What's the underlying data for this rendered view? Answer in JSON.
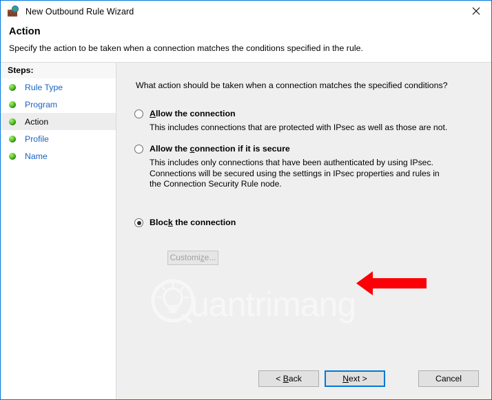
{
  "window": {
    "title": "New Outbound Rule Wizard",
    "icon": "firewall-globe-icon",
    "close_label": "✕",
    "border_color": "#0078d7"
  },
  "header": {
    "title": "Action",
    "subtitle": "Specify the action to be taken when a connection matches the conditions specified in the rule."
  },
  "sidebar": {
    "heading": "Steps:",
    "items": [
      {
        "label": "Rule Type",
        "state": "link"
      },
      {
        "label": "Program",
        "state": "link"
      },
      {
        "label": "Action",
        "state": "current"
      },
      {
        "label": "Profile",
        "state": "link"
      },
      {
        "label": "Name",
        "state": "link"
      }
    ],
    "link_color": "#1a62c4",
    "current_color": "#000000"
  },
  "content": {
    "question": "What action should be taken when a connection matches the specified conditions?",
    "options": [
      {
        "id": "allow",
        "label_pre": "",
        "label_accel": "A",
        "label_post": "llow the connection",
        "label_full": "Allow the connection",
        "description": "This includes connections that are protected with IPsec as well as those are not.",
        "selected": false
      },
      {
        "id": "allow-secure",
        "label_pre": "Allow the ",
        "label_accel": "c",
        "label_post": "onnection if it is secure",
        "label_full": "Allow the connection if it is secure",
        "description": "This includes only connections that have been authenticated by using IPsec.  Connections will be secured using the settings in IPsec properties and rules in the Connection Security Rule node.",
        "selected": false
      },
      {
        "id": "block",
        "label_pre": "Bloc",
        "label_accel": "k",
        "label_post": " the connection",
        "label_full": "Block the connection",
        "description": "",
        "selected": true
      }
    ],
    "customize_button": {
      "label_pre": "Customi",
      "label_accel": "z",
      "label_post": "e...",
      "label_full": "Customize...",
      "enabled": false
    },
    "annotation": {
      "type": "arrow",
      "direction": "left",
      "color": "#fb0006",
      "points_to": "Block the connection"
    },
    "watermark": {
      "text": "Quantrimang",
      "logo": "lightbulb-in-circle-icon"
    },
    "background_color": "#efefef"
  },
  "footer": {
    "back": {
      "label_pre": "< ",
      "label_accel": "B",
      "label_post": "ack",
      "label_full": "< Back"
    },
    "next": {
      "label_pre": "",
      "label_accel": "N",
      "label_post": "ext >",
      "label_full": "Next >",
      "is_default": true
    },
    "cancel": {
      "label_full": "Cancel"
    }
  }
}
